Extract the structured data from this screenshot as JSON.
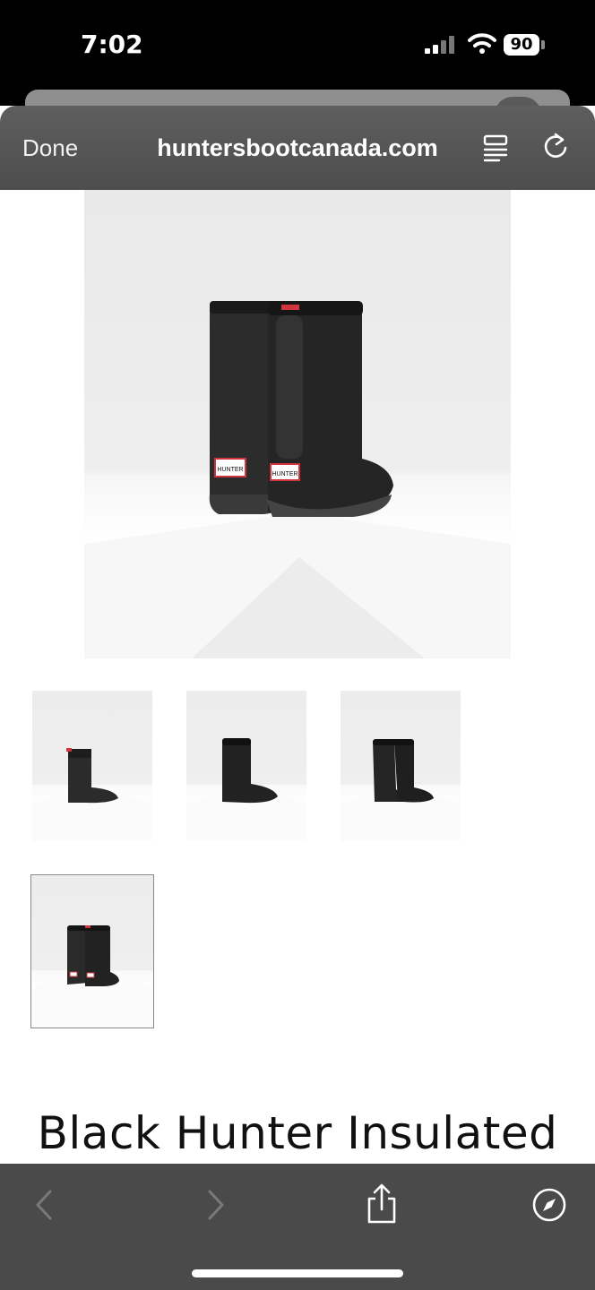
{
  "status_bar": {
    "time": "7:02",
    "battery": "90"
  },
  "browser": {
    "done_label": "Done",
    "url": "huntersbootcanada.com",
    "icons": {
      "reader": "reader-view-icon",
      "reload": "reload-icon",
      "back": "chevron-left-icon",
      "forward": "chevron-right-icon",
      "share": "share-icon",
      "safari": "compass-icon"
    }
  },
  "product": {
    "title": "Black Hunter Insulated",
    "label_text": "HUNTER",
    "thumbnails": [
      {
        "name": "side view"
      },
      {
        "name": "front side view"
      },
      {
        "name": "pair front view"
      },
      {
        "name": "pair back view",
        "selected": true
      }
    ]
  },
  "colors": {
    "brand_label_red": "#d0343c",
    "boot": "#2a2a2a"
  }
}
